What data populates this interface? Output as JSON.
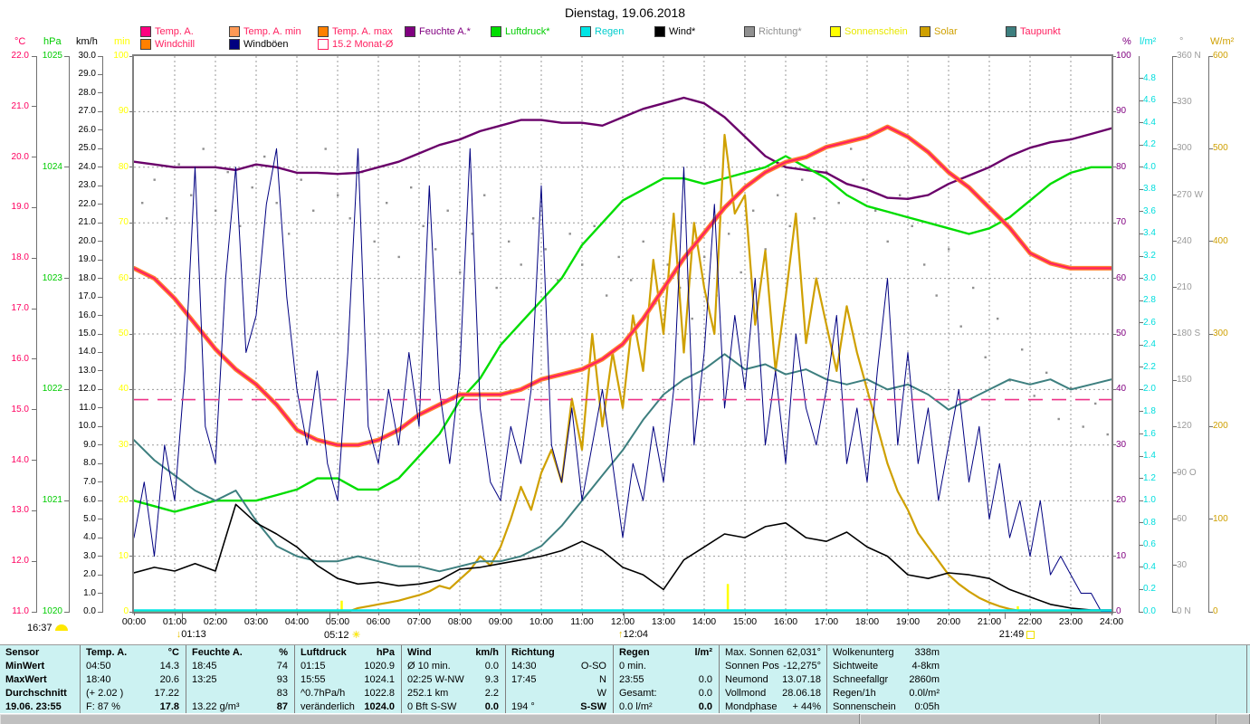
{
  "title": "Dienstag, 19.06.2018",
  "legend": {
    "row1": [
      {
        "label": "Temp. A.",
        "box": "#ff0080",
        "text": "#ff2060"
      },
      {
        "label": "Temp. A. min",
        "box": "#ff9955",
        "text": "#ff2060"
      },
      {
        "label": "Temp. A. max",
        "box": "#ff8000",
        "text": "#ff2060"
      },
      {
        "label": "Feuchte A.*",
        "box": "#800080",
        "text": "#800080"
      },
      {
        "label": "Luftdruck*",
        "box": "#00dd00",
        "text": "#00cc00"
      },
      {
        "label": "Regen",
        "box": "#00e5e5",
        "text": "#00cccc"
      },
      {
        "label": "Wind*",
        "box": "#000000",
        "text": "#000000"
      },
      {
        "label": "Richtung*",
        "box": "#909090",
        "text": "#909090"
      },
      {
        "label": "Sonnenschein",
        "box": "#ffff00",
        "text": "#e8e800"
      },
      {
        "label": "Solar",
        "box": "#cfa000",
        "text": "#cfa000"
      },
      {
        "label": "Taupunkt",
        "box": "#3d7f7f",
        "text": "#ff2060"
      }
    ],
    "row2": [
      {
        "label": "Windchill",
        "box": "#ff8000",
        "text": "#ff2060"
      },
      {
        "label": "Windböen",
        "box": "#000080",
        "text": "#000000"
      },
      {
        "label": "15.2 Monat-Ø",
        "box": "#ffffff",
        "text": "#ff2060",
        "box_border": "#ff2060"
      }
    ]
  },
  "axes": {
    "left": [
      {
        "id": "degc",
        "header": "°C",
        "color": "#ff0060",
        "min": 11,
        "max": 22,
        "step": 1,
        "decimals": 1
      },
      {
        "id": "hpa",
        "header": "hPa",
        "color": "#00cc00",
        "min": 1020,
        "max": 1025,
        "step": 1,
        "decimals": 0
      },
      {
        "id": "kmh",
        "header": "km/h",
        "color": "#000000",
        "min": 0,
        "max": 30,
        "step": 1,
        "decimals": 1
      },
      {
        "id": "min",
        "header": "min",
        "color": "#ffff00",
        "min": 0,
        "max": 100,
        "step": 10,
        "decimals": 0
      }
    ],
    "right": [
      {
        "id": "pct",
        "header": "%",
        "color": "#800080",
        "min": 0,
        "max": 100,
        "step": 10,
        "decimals": 0
      },
      {
        "id": "lm2",
        "header": "l/m²",
        "color": "#00dddd",
        "min": 0,
        "max": 5,
        "step": 0.2,
        "decimals": 1,
        "hide_top": true
      },
      {
        "id": "deg",
        "header": "°",
        "color": "#9a9a9a",
        "min": 0,
        "max": 360,
        "step": 30,
        "decimals": 0,
        "special": {
          "0": "0 N",
          "90": "90 O",
          "180": "180 S",
          "270": "270 W",
          "360": "360 N"
        }
      },
      {
        "id": "wm2",
        "header": "W/m²",
        "color": "#cfa000",
        "min": 0,
        "max": 600,
        "step": 100,
        "decimals": 0
      }
    ]
  },
  "time_axis": [
    "00:00",
    "01:00",
    "02:00",
    "03:00",
    "04:00",
    "05:00",
    "06:00",
    "07:00",
    "08:00",
    "09:00",
    "10:00",
    "11:00",
    "12:00",
    "13:00",
    "14:00",
    "15:00",
    "16:00",
    "17:00",
    "18:00",
    "19:00",
    "20:00",
    "21:00",
    "22:00",
    "23:00",
    "24:00"
  ],
  "events": {
    "moonset": {
      "time": "01:13",
      "icon": "down-arrow"
    },
    "sunrise": {
      "time": "05:12",
      "icon": "sun"
    },
    "moonrise": {
      "time": "12:04",
      "icon": "up-arrow"
    },
    "sunset": {
      "time": "21:49",
      "icon": "open-square"
    },
    "bottom_left_time": "16:37"
  },
  "chart_data": {
    "type": "line",
    "title": "Dienstag, 19.06.2018",
    "x_range_hours": [
      0,
      24
    ],
    "grid": "on",
    "month_avg_line": {
      "axis": "degc",
      "value": 15.2,
      "color": "#ee3388",
      "label": "15.2 Monat-Ø"
    },
    "series": [
      {
        "name": "Feuchte A.",
        "axis": "pct",
        "color": "#6a006a",
        "width": 2.4,
        "step_h": 0.5,
        "values": [
          81,
          80.5,
          80,
          80,
          80,
          79.5,
          80.5,
          80,
          79,
          79,
          78.8,
          79,
          80,
          81,
          82.5,
          84,
          85,
          86.5,
          87.5,
          88.5,
          88.5,
          88,
          88,
          87.5,
          89,
          90.5,
          91.5,
          92.5,
          91.5,
          89,
          85.5,
          82,
          80,
          79.5,
          79,
          77,
          76,
          74.5,
          74.3,
          75,
          77,
          78.5,
          80,
          82,
          83.5,
          84.5,
          85,
          86,
          87
        ]
      },
      {
        "name": "Luftdruck",
        "axis": "hpa",
        "color": "#00dd00",
        "width": 2.4,
        "step_h": 0.5,
        "values": [
          1021.0,
          1020.95,
          1020.9,
          1020.95,
          1021.0,
          1021.0,
          1021.0,
          1021.05,
          1021.1,
          1021.2,
          1021.2,
          1021.1,
          1021.1,
          1021.2,
          1021.4,
          1021.6,
          1021.9,
          1022.1,
          1022.4,
          1022.6,
          1022.8,
          1023.0,
          1023.3,
          1023.5,
          1023.7,
          1023.8,
          1023.9,
          1023.9,
          1023.85,
          1023.9,
          1023.95,
          1024.0,
          1024.1,
          1024.0,
          1023.9,
          1023.75,
          1023.65,
          1023.6,
          1023.55,
          1023.5,
          1023.45,
          1023.4,
          1023.45,
          1023.55,
          1023.7,
          1023.85,
          1023.95,
          1024.0,
          1024.0
        ]
      },
      {
        "name": "Solar",
        "axis": "wm2",
        "color": "#cfa000",
        "width": 2.2,
        "step_h": 0.25,
        "values": [
          0,
          0,
          0,
          0,
          0,
          0,
          0,
          0,
          0,
          0,
          0,
          0,
          0,
          0,
          0,
          0,
          0,
          0,
          0,
          0,
          0,
          0,
          4,
          6,
          8,
          10,
          12,
          15,
          18,
          22,
          28,
          25,
          35,
          45,
          60,
          50,
          70,
          100,
          135,
          110,
          150,
          175,
          140,
          230,
          175,
          300,
          200,
          280,
          220,
          320,
          260,
          380,
          300,
          430,
          280,
          420,
          350,
          300,
          515,
          430,
          450,
          310,
          390,
          260,
          340,
          430,
          290,
          360,
          310,
          260,
          330,
          280,
          240,
          200,
          160,
          130,
          110,
          85,
          70,
          55,
          40,
          30,
          22,
          15,
          10,
          6,
          3,
          1,
          0,
          0,
          0,
          0,
          0,
          0,
          0,
          0,
          0
        ]
      },
      {
        "name": "Temp. A.",
        "axis": "degc",
        "color": "#ff2060",
        "halo": "#ff8030",
        "width": 2.2,
        "step_h": 0.5,
        "values": [
          17.8,
          17.6,
          17.2,
          16.7,
          16.2,
          15.8,
          15.5,
          15.1,
          14.6,
          14.4,
          14.3,
          14.3,
          14.4,
          14.6,
          14.9,
          15.1,
          15.3,
          15.3,
          15.3,
          15.4,
          15.6,
          15.7,
          15.8,
          16.0,
          16.3,
          16.8,
          17.4,
          18.0,
          18.5,
          19.0,
          19.4,
          19.7,
          19.9,
          20.0,
          20.2,
          20.3,
          20.4,
          20.6,
          20.4,
          20.1,
          19.7,
          19.4,
          19.0,
          18.6,
          18.1,
          17.9,
          17.8,
          17.8,
          17.8
        ]
      },
      {
        "name": "Taupunkt",
        "axis": "degc",
        "color": "#3d7f7f",
        "width": 2.0,
        "step_h": 0.5,
        "values": [
          14.4,
          14.0,
          13.7,
          13.4,
          13.2,
          13.4,
          12.8,
          12.3,
          12.1,
          12.0,
          12.0,
          12.1,
          12.0,
          11.9,
          11.9,
          11.8,
          11.9,
          12.0,
          12.0,
          12.1,
          12.3,
          12.7,
          13.2,
          13.7,
          14.2,
          14.8,
          15.3,
          15.6,
          15.8,
          16.1,
          15.8,
          15.9,
          15.7,
          15.8,
          15.6,
          15.5,
          15.6,
          15.4,
          15.5,
          15.3,
          15.0,
          15.2,
          15.4,
          15.6,
          15.5,
          15.6,
          15.4,
          15.5,
          15.6
        ]
      },
      {
        "name": "Wind",
        "axis": "kmh",
        "color": "#000000",
        "width": 1.6,
        "step_h": 0.5,
        "values": [
          2.1,
          2.4,
          2.2,
          2.6,
          2.2,
          5.8,
          4.8,
          4.2,
          3.5,
          2.5,
          1.8,
          1.5,
          1.6,
          1.4,
          1.5,
          1.7,
          2.3,
          2.4,
          2.6,
          2.8,
          3.0,
          3.3,
          3.8,
          3.3,
          2.4,
          2.0,
          1.2,
          2.8,
          3.5,
          4.2,
          4.0,
          4.6,
          4.8,
          4.0,
          3.8,
          4.3,
          3.5,
          3.0,
          2.0,
          1.8,
          2.1,
          2.0,
          1.8,
          1.2,
          0.8,
          0.4,
          0.2,
          0.1,
          0.1
        ]
      },
      {
        "name": "Windböen",
        "axis": "kmh",
        "color": "#000080",
        "width": 1.0,
        "step_h": 0.25,
        "values": [
          4,
          7,
          3,
          9,
          6,
          13,
          24,
          10,
          8,
          18,
          24,
          14,
          16,
          22,
          25,
          17,
          12,
          9,
          13,
          8,
          6,
          14,
          25,
          10,
          8,
          12,
          9,
          14,
          10,
          23,
          12,
          8,
          13,
          25,
          11,
          7,
          6,
          10,
          8,
          12,
          23,
          9,
          7,
          11,
          6,
          9,
          12,
          8,
          4,
          8,
          6,
          10,
          7,
          12,
          24,
          9,
          14,
          22,
          11,
          16,
          12,
          18,
          9,
          13,
          8,
          15,
          11,
          9,
          12,
          16,
          8,
          11,
          7,
          13,
          18,
          9,
          14,
          8,
          11,
          6,
          9,
          12,
          7,
          10,
          5,
          8,
          4,
          6,
          3,
          6,
          2,
          3,
          2,
          1,
          1,
          0,
          0
        ]
      },
      {
        "name": "Regen",
        "axis": "lm2",
        "color": "#00e5e5",
        "width": 2.4,
        "step_h": 12,
        "values": [
          0,
          0,
          0
        ]
      }
    ],
    "sunshine_bars": {
      "name": "Sonnenschein",
      "axis": "min",
      "color": "#ffff00",
      "bars": [
        {
          "x_h": 5.1,
          "minutes": 2
        },
        {
          "x_h": 14.58,
          "minutes": 5
        },
        {
          "x_h": 21.7,
          "minutes": 1
        }
      ]
    },
    "direction_scatter": {
      "name": "Richtung",
      "axis": "deg",
      "color": "#909090",
      "points": [
        [
          0.2,
          265
        ],
        [
          0.5,
          280
        ],
        [
          0.8,
          255
        ],
        [
          1.1,
          290
        ],
        [
          1.4,
          270
        ],
        [
          1.7,
          300
        ],
        [
          2.0,
          260
        ],
        [
          2.3,
          285
        ],
        [
          2.6,
          250
        ],
        [
          2.9,
          275
        ],
        [
          3.2,
          295
        ],
        [
          3.5,
          265
        ],
        [
          3.8,
          245
        ],
        [
          4.1,
          280
        ],
        [
          4.4,
          260
        ],
        [
          4.7,
          300
        ],
        [
          5.0,
          270
        ],
        [
          5.3,
          255
        ],
        [
          5.6,
          285
        ],
        [
          5.9,
          240
        ],
        [
          6.2,
          265
        ],
        [
          6.5,
          230
        ],
        [
          6.8,
          275
        ],
        [
          7.1,
          250
        ],
        [
          7.4,
          235
        ],
        [
          7.7,
          260
        ],
        [
          8.0,
          220
        ],
        [
          8.3,
          245
        ],
        [
          8.6,
          270
        ],
        [
          8.9,
          210
        ],
        [
          9.2,
          240
        ],
        [
          9.5,
          225
        ],
        [
          9.8,
          255
        ],
        [
          10.1,
          235
        ],
        [
          10.4,
          215
        ],
        [
          10.7,
          245
        ],
        [
          11.0,
          225
        ],
        [
          11.3,
          250
        ],
        [
          11.6,
          205
        ],
        [
          11.9,
          230
        ],
        [
          12.2,
          215
        ],
        [
          12.5,
          240
        ],
        [
          12.8,
          200
        ],
        [
          13.1,
          225
        ],
        [
          13.4,
          210
        ],
        [
          13.7,
          190
        ],
        [
          14.0,
          230
        ],
        [
          14.3,
          205
        ],
        [
          14.6,
          245
        ],
        [
          14.9,
          220
        ],
        [
          15.2,
          260
        ],
        [
          15.5,
          235
        ],
        [
          15.8,
          270
        ],
        [
          16.1,
          250
        ],
        [
          16.4,
          280
        ],
        [
          16.7,
          255
        ],
        [
          17.0,
          285
        ],
        [
          17.3,
          265
        ],
        [
          17.6,
          300
        ],
        [
          17.9,
          280
        ],
        [
          18.2,
          260
        ],
        [
          18.5,
          240
        ],
        [
          18.8,
          270
        ],
        [
          19.1,
          250
        ],
        [
          19.4,
          225
        ],
        [
          19.7,
          205
        ],
        [
          20.0,
          235
        ],
        [
          20.3,
          185
        ],
        [
          20.6,
          210
        ],
        [
          20.9,
          165
        ],
        [
          21.2,
          190
        ],
        [
          21.5,
          150
        ],
        [
          21.8,
          170
        ],
        [
          22.1,
          140
        ],
        [
          22.4,
          155
        ],
        [
          22.7,
          125
        ],
        [
          23.0,
          145
        ],
        [
          23.3,
          120
        ],
        [
          23.6,
          135
        ],
        [
          23.9,
          115
        ]
      ]
    }
  },
  "table": {
    "sensor_col": {
      "header": "Sensor",
      "rows": [
        "MinWert",
        "MaxWert",
        "Durchschnitt",
        "19.06. 23:55"
      ]
    },
    "value_cols": [
      {
        "header": "Temp. A.",
        "unit": "°C",
        "rows": [
          [
            "04:50",
            "14.3"
          ],
          [
            "18:40",
            "20.6"
          ],
          [
            "(+ 2.02 )",
            "17.22"
          ],
          [
            "F: 87 %",
            "17.8"
          ]
        ]
      },
      {
        "header": "Feuchte A.",
        "unit": "%",
        "rows": [
          [
            "18:45",
            "74"
          ],
          [
            "13:25",
            "93"
          ],
          [
            "",
            "83"
          ],
          [
            "13.22 g/m³",
            "87"
          ]
        ]
      },
      {
        "header": "Luftdruck",
        "unit": "hPa",
        "rows": [
          [
            "01:15",
            "1020.9"
          ],
          [
            "15:55",
            "1024.1"
          ],
          [
            "^0.7hPa/h",
            "1022.8"
          ],
          [
            "veränderlich",
            "1024.0"
          ]
        ]
      },
      {
        "header": "Wind",
        "unit": "km/h",
        "rows": [
          [
            "Ø 10 min.",
            "0.0"
          ],
          [
            "02:25  W-NW",
            "9.3"
          ],
          [
            "252.1 km",
            "2.2"
          ],
          [
            "0 Bft S-SW",
            "0.0"
          ]
        ]
      },
      {
        "header": "Richtung",
        "unit": "",
        "rows": [
          [
            "14:30",
            "O-SO"
          ],
          [
            "17:45",
            "N"
          ],
          [
            "",
            "W"
          ],
          [
            "194 °",
            "S-SW"
          ]
        ]
      },
      {
        "header": "Regen",
        "unit": "l/m²",
        "rows": [
          [
            "0 min.",
            ""
          ],
          [
            "23:55",
            "0.0"
          ],
          [
            "Gesamt:",
            "0.0"
          ],
          [
            "0.0 l/m²",
            "0.0"
          ]
        ]
      }
    ],
    "info_col1": [
      [
        "Max. Sonnen",
        "62,031°"
      ],
      [
        "Sonnen Pos",
        "-12,275°"
      ],
      [
        "Neumond",
        "13.07.18"
      ],
      [
        "Vollmond",
        "28.06.18"
      ],
      [
        "Mondphase",
        "+ 44%"
      ]
    ],
    "info_col2": [
      [
        "Wolkenunterg",
        "338m"
      ],
      [
        "Sichtweite",
        "4-8km"
      ],
      [
        "Schneefallgr",
        "2860m"
      ],
      [
        "Regen/1h",
        "0.0l/m²"
      ],
      [
        "Sonnenschein",
        "0:05h"
      ]
    ]
  }
}
